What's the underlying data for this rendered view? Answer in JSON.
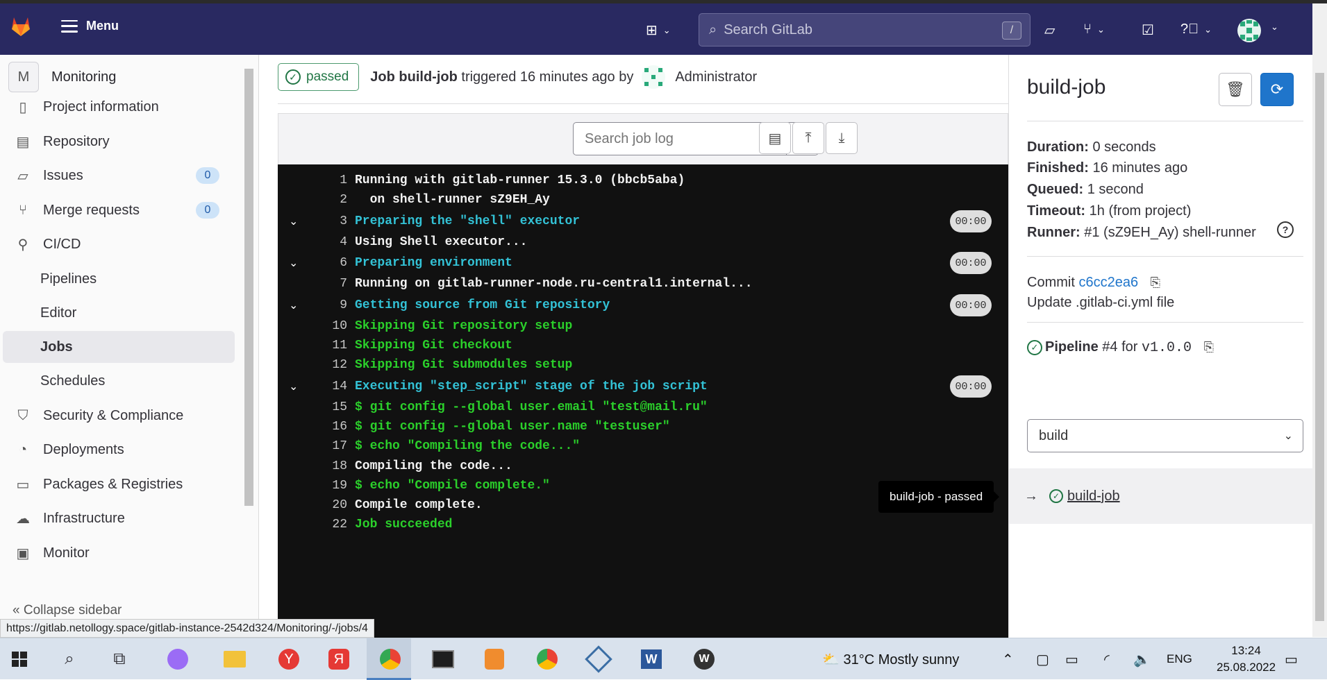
{
  "header": {
    "menu_label": "Menu",
    "search_placeholder": "Search GitLab",
    "search_shortcut": "/"
  },
  "sidebar": {
    "project_initial": "M",
    "project_name": "Monitoring",
    "items": [
      {
        "label": "Project information",
        "icon": "info-icon"
      },
      {
        "label": "Repository",
        "icon": "book-icon"
      },
      {
        "label": "Issues",
        "icon": "issues-icon",
        "badge": "0"
      },
      {
        "label": "Merge requests",
        "icon": "merge-request-icon",
        "badge": "0"
      },
      {
        "label": "CI/CD",
        "icon": "rocket-icon"
      },
      {
        "label": "Pipelines",
        "sub": true
      },
      {
        "label": "Editor",
        "sub": true
      },
      {
        "label": "Jobs",
        "sub": true,
        "active": true
      },
      {
        "label": "Schedules",
        "sub": true
      },
      {
        "label": "Security & Compliance",
        "icon": "shield-icon"
      },
      {
        "label": "Deployments",
        "icon": "deployments-icon"
      },
      {
        "label": "Packages & Registries",
        "icon": "package-icon"
      },
      {
        "label": "Infrastructure",
        "icon": "cloud-gear-icon"
      },
      {
        "label": "Monitor",
        "icon": "monitor-icon"
      }
    ],
    "collapse_label": "Collapse sidebar"
  },
  "status_url": "https://gitlab.netollogy.space/gitlab-instance-2542d324/Monitoring/-/jobs/4",
  "job": {
    "status": "passed",
    "prefix": "Job",
    "name": "build-job",
    "triggered": "triggered 16 minutes ago by",
    "user": "Administrator"
  },
  "log_toolbar": {
    "search_placeholder": "Search job log",
    "help": "?"
  },
  "log": [
    {
      "n": "1",
      "text": "Running with gitlab-runner 15.3.0 (bbcb5aba)",
      "color": "white"
    },
    {
      "n": "2",
      "text": "  on shell-runner sZ9EH_Ay",
      "color": "white"
    },
    {
      "n": "3",
      "text": "Preparing the \"shell\" executor",
      "color": "cyan",
      "section": true,
      "dur": "00:00"
    },
    {
      "n": "4",
      "text": "Using Shell executor...",
      "color": "white"
    },
    {
      "n": "6",
      "text": "Preparing environment",
      "color": "cyan",
      "section": true,
      "dur": "00:00"
    },
    {
      "n": "7",
      "text": "Running on gitlab-runner-node.ru-central1.internal...",
      "color": "white"
    },
    {
      "n": "9",
      "text": "Getting source from Git repository",
      "color": "cyan",
      "section": true,
      "dur": "00:00"
    },
    {
      "n": "10",
      "text": "Skipping Git repository setup",
      "color": "green"
    },
    {
      "n": "11",
      "text": "Skipping Git checkout",
      "color": "green"
    },
    {
      "n": "12",
      "text": "Skipping Git submodules setup",
      "color": "green"
    },
    {
      "n": "14",
      "text": "Executing \"step_script\" stage of the job script",
      "color": "cyan",
      "section": true,
      "dur": "00:00"
    },
    {
      "n": "15",
      "text": "$ git config --global user.email \"test@mail.ru\"",
      "color": "green"
    },
    {
      "n": "16",
      "text": "$ git config --global user.name \"testuser\"",
      "color": "green"
    },
    {
      "n": "17",
      "text": "$ echo \"Compiling the code...\"",
      "color": "green"
    },
    {
      "n": "18",
      "text": "Compiling the code...",
      "color": "white"
    },
    {
      "n": "19",
      "text": "$ echo \"Compile complete.\"",
      "color": "green"
    },
    {
      "n": "20",
      "text": "Compile complete.",
      "color": "white"
    },
    {
      "n": "22",
      "text": "Job succeeded",
      "color": "green"
    }
  ],
  "tooltip": "build-job - passed",
  "right": {
    "title": "build-job",
    "duration_label": "Duration:",
    "duration": "0 seconds",
    "finished_label": "Finished:",
    "finished": "16 minutes ago",
    "queued_label": "Queued:",
    "queued": "1 second",
    "timeout_label": "Timeout:",
    "timeout": "1h (from project)",
    "runner_label": "Runner:",
    "runner": "#1 (sZ9EH_Ay) shell-runner",
    "commit_label": "Commit",
    "commit_sha": "c6cc2ea6",
    "commit_msg": "Update .gitlab-ci.yml file",
    "pipeline_label": "Pipeline",
    "pipeline_id": "#4",
    "pipeline_for": "for",
    "pipeline_ref": "v1.0.0",
    "stage": "build",
    "job_link": "build-job"
  },
  "taskbar": {
    "weather": "31°C  Mostly sunny",
    "lang": "ENG",
    "time": "13:24",
    "date": "25.08.2022"
  }
}
